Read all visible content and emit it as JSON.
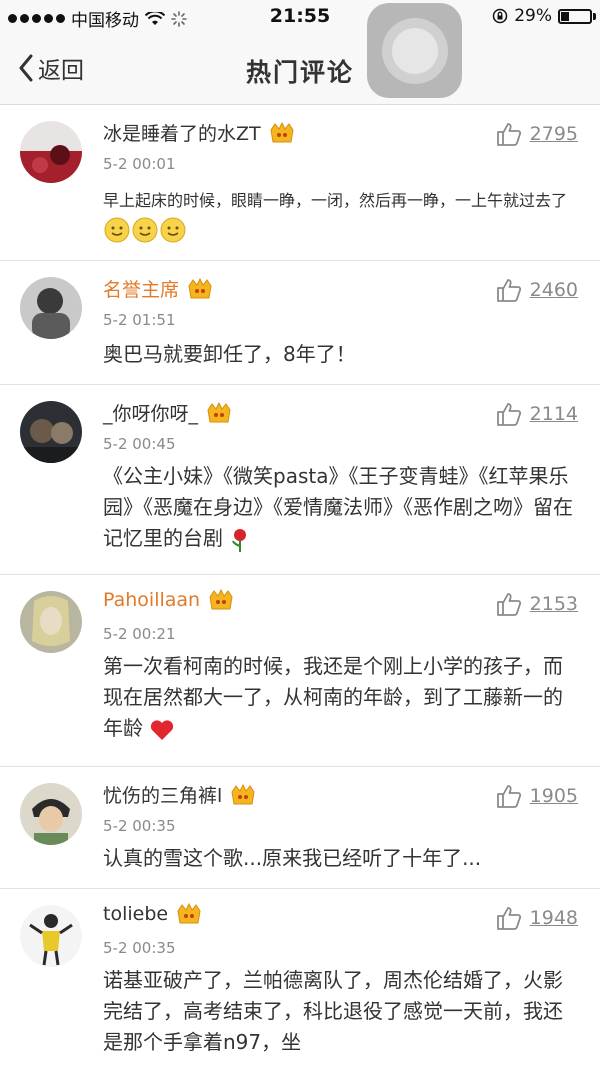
{
  "status_bar": {
    "carrier": "中国移动",
    "time": "21:55",
    "battery": "29%",
    "battery_level": 0.29
  },
  "nav": {
    "back_label": "返回",
    "title": "热门评论"
  },
  "comments": [
    {
      "name": "冰是睡着了的水ZT",
      "time": "5-2 00:01",
      "likes": "2795",
      "text": "早上起床的时候，眼睛一睁，一闭，然后再一睁，一上午就过去了"
    },
    {
      "name": "名誉主席",
      "time": "5-2 01:51",
      "likes": "2460",
      "text": "奥巴马就要卸任了，8年了！"
    },
    {
      "name": "_你呀你呀_",
      "time": "5-2 00:45",
      "likes": "2114",
      "text": "《公主小妹》《微笑pasta》《王子变青蛙》《红苹果乐园》《恶魔在身边》《爱情魔法师》《恶作剧之吻》留在记忆里的台剧"
    },
    {
      "name": "Pahoillaan",
      "time": "5-2 00:21",
      "likes": "2153",
      "text": "第一次看柯南的时候，我还是个刚上小学的孩子，而现在居然都大一了，从柯南的年龄，到了工藤新一的年龄"
    },
    {
      "name": "忧伤的三角裤l",
      "time": "5-2 00:35",
      "likes": "1905",
      "text": "认真的雪这个歌...原来我已经听了十年了..."
    },
    {
      "name": "toliebe",
      "time": "5-2 00:35",
      "likes": "1948",
      "text": "诺基亚破产了，兰帕德离队了，周杰伦结婚了，火影完结了，高考结束了，科比退役了感觉一天前，我还是那个手拿着n97，坐"
    }
  ]
}
